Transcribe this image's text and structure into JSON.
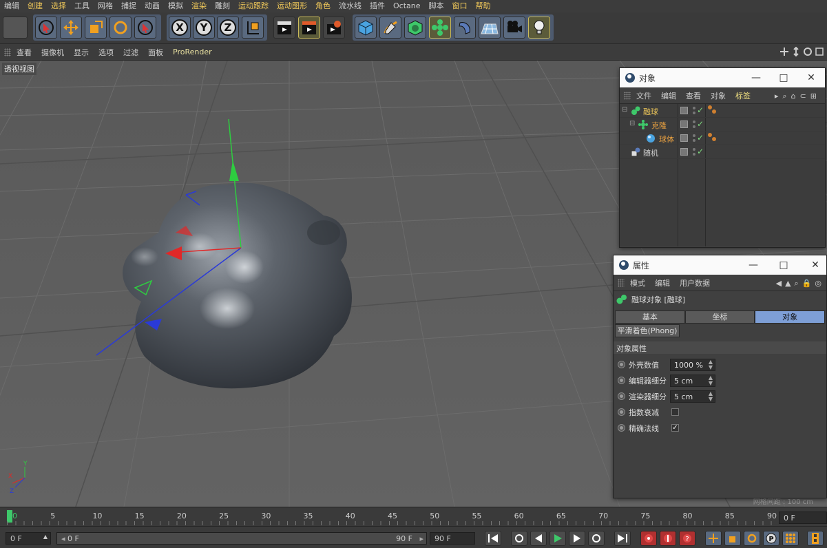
{
  "menubar": [
    "编辑",
    "创建",
    "选择",
    "工具",
    "网格",
    "捕捉",
    "动画",
    "模拟",
    "渲染",
    "雕刻",
    "运动跟踪",
    "运动图形",
    "角色",
    "流水线",
    "插件",
    "Octane",
    "脚本",
    "窗口",
    "帮助"
  ],
  "viewport_menu": [
    "查看",
    "摄像机",
    "显示",
    "选项",
    "过滤",
    "面板",
    "ProRender"
  ],
  "viewport_label": "透视视图",
  "axes": {
    "x": "X",
    "y": "Y",
    "z": "Z"
  },
  "object_manager": {
    "title": "对象",
    "menu": [
      "文件",
      "编辑",
      "查看",
      "对象",
      "标签"
    ],
    "objects": [
      {
        "name": "融球",
        "color": "#f0c85a",
        "indent": 0,
        "has_tag": true
      },
      {
        "name": "克隆",
        "color": "#e8a040",
        "indent": 1,
        "has_tag": false
      },
      {
        "name": "球体",
        "color": "#e8a040",
        "indent": 2,
        "has_tag": true
      },
      {
        "name": "随机",
        "color": "#cfcfcf",
        "indent": 0,
        "has_tag": false
      }
    ]
  },
  "attributes": {
    "title": "属性",
    "menu": [
      "模式",
      "编辑",
      "用户数据"
    ],
    "object_title": "融球对象 [融球]",
    "tabs": [
      {
        "label": "基本",
        "active": false
      },
      {
        "label": "坐标",
        "active": false
      },
      {
        "label": "对象",
        "active": true
      }
    ],
    "subtab": "平滑着色(Phong)",
    "section": "对象属性",
    "props": [
      {
        "label": "外壳数值",
        "value": "1000 %",
        "type": "number"
      },
      {
        "label": "编辑器细分",
        "value": "5 cm",
        "type": "number"
      },
      {
        "label": "渲染器细分",
        "value": "5 cm",
        "type": "number"
      },
      {
        "label": "指数衰减",
        "checked": false,
        "type": "checkbox"
      },
      {
        "label": "精确法线",
        "checked": true,
        "type": "checkbox"
      }
    ],
    "grid_note": "网格间距 : 100 cm"
  },
  "timeline": {
    "ticks": [
      "0",
      "5",
      "10",
      "15",
      "20",
      "25",
      "30",
      "35",
      "40",
      "45",
      "50",
      "55",
      "60",
      "65",
      "70",
      "75",
      "80",
      "85",
      "90"
    ],
    "frame_display": "0 F"
  },
  "controls": {
    "start": "0 F",
    "range_start": "0 F",
    "range_end": "90 F",
    "end": "90 F"
  }
}
